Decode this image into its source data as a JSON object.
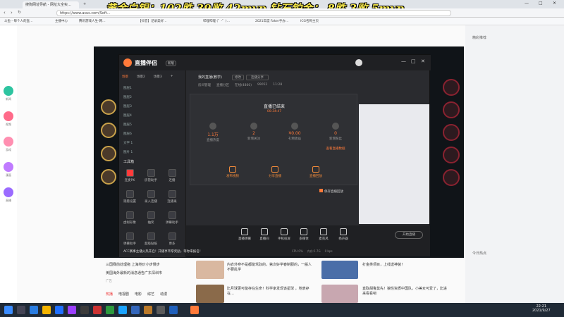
{
  "overlay": {
    "title": "黄金白银：102胜 39败 42mvp 钻石铂金： 8胜 3败 5mvp"
  },
  "browser": {
    "tabs": [
      "搜狗网址导航 - 网址大全实…",
      "+"
    ],
    "address": "https://www.asus.com/Soft…",
    "bookmarks": [
      "斗鱼 - 每个人的直…",
      "主播中心",
      "腾讯游戏人生-网…",
      "【抖音】记录美好…",
      "哔哩哔哩 (゜-゜)…",
      "2021年度 Faker手办…",
      "ICG名称主页"
    ],
    "chrome_buttons": [
      "—",
      "□",
      "✕"
    ]
  },
  "left_rail": [
    "新闻",
    "视频",
    "游戏",
    "漫画",
    "直播"
  ],
  "app": {
    "logo": "直播伴侣",
    "version": "新版",
    "scene_tabs": [
      "场景",
      "场景2",
      "场景3"
    ],
    "layers": [
      "图层1",
      "图层2",
      "图层3",
      "图层4",
      "图层5",
      "图层6",
      "文字 1",
      "图片 1"
    ],
    "tools_label": "工具箱",
    "tools": [
      "连麦PK",
      "房管助手",
      "连播",
      "观看设置",
      "录入连播",
      "连播录",
      "虚拟形象",
      "抽奖",
      "弹幕助手",
      "弹幕助手",
      "超级贴纸",
      "更多"
    ],
    "stream_title": "我的直播(教学)",
    "title_edit": "修改",
    "share": "连播分享",
    "room_info": [
      "房间管理",
      "直播分区",
      "在线(4860)",
      "99052",
      "11:28"
    ],
    "end_panel": {
      "title": "直播已结束",
      "duration": "00:34:47",
      "stats": [
        {
          "value": "1.1万",
          "label": "直播热度"
        },
        {
          "value": "2",
          "label": "新增关注"
        },
        {
          "value": "¥0.00",
          "label": "礼物收益"
        },
        {
          "value": "0",
          "label": "新增粉丝"
        }
      ],
      "link": "查看直播数据",
      "actions": [
        "发布视频",
        "分享直播",
        "直播回放"
      ]
    },
    "notice_checkbox": "保存直播回放",
    "bottom_tools": [
      "直播弹幕",
      "直播间",
      "手机投屏",
      "多媒体",
      "麦克风",
      "扬声器"
    ],
    "start_button": "开始直播",
    "footer_notice": "AFC赛事主播火热开启！开播享丰厚奖励，等你来报名！",
    "status_bar": [
      "CPU 0%",
      "内存:1.7G",
      "0 bps"
    ]
  },
  "articles": [
    {
      "title": "内衣外穿不是都能驾驭的，第次好学春制服的，一般人不要乱学"
    },
    {
      "title": "比月球更可能存在生命！科学家发现该星球 ，地表存在…"
    },
    {
      "title": "打金类项目，上线送神装！"
    },
    {
      "title": "直取胡鲁莫先！狼性资质中国队，小美女可爱了，比进来看看吧"
    }
  ],
  "left_articles": [
    "三国赛前处理拖 上海地价小步慢步",
    "美国海外最新的消息通告广东深圳市",
    "广告"
  ],
  "bottom_nav": [
    "热播",
    "电视剧",
    "电影",
    "综艺",
    "动漫"
  ],
  "aside_texts": [
    "精彩推荐",
    "今日热点"
  ],
  "taskbar": {
    "time": "22:21",
    "date": "2021/9/27"
  },
  "colors": {
    "overlay_yellow": "#f6e84a",
    "app_accent": "#ff7a3a",
    "page_bg": "#fafafa"
  }
}
